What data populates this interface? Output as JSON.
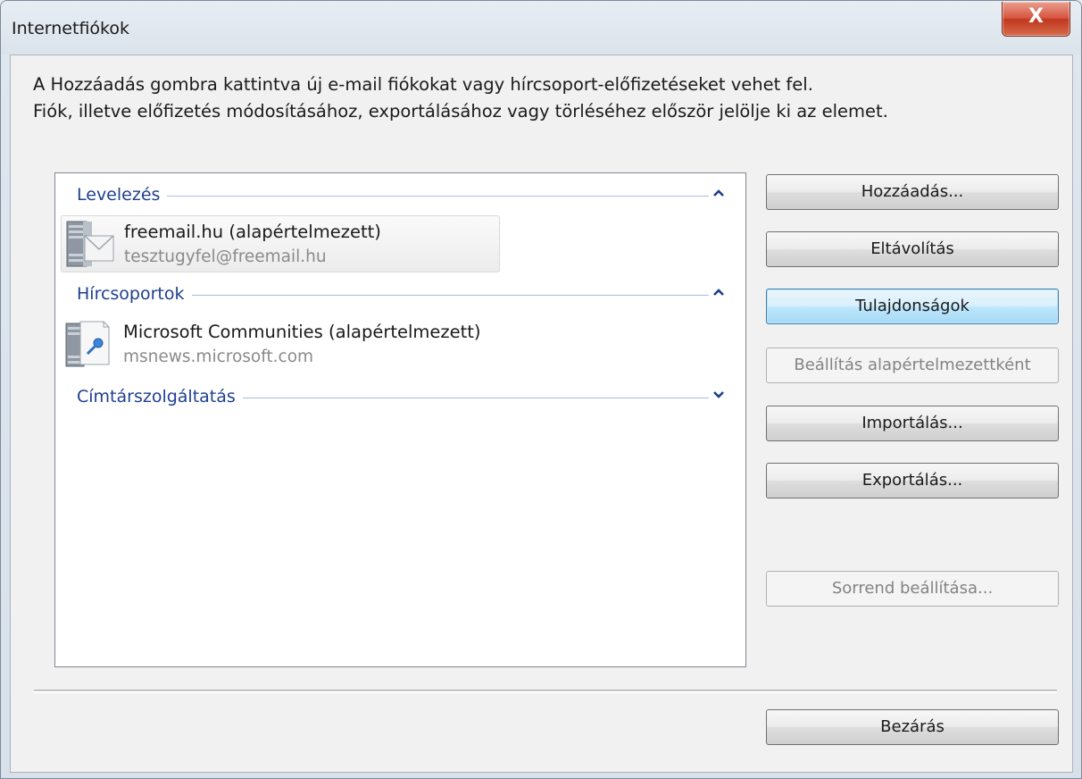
{
  "window": {
    "title": "Internetfiókok",
    "close_glyph": "X"
  },
  "info": {
    "line1": "A Hozzáadás gombra kattintva új e-mail fiókokat vagy hírcsoport-előfizetéseket vehet fel.",
    "line2": "Fiók, illetve előfizetés módosításához, exportálásához vagy törléséhez először jelölje ki az elemet."
  },
  "groups": {
    "mail": {
      "label": "Levelezés",
      "chevron": "^",
      "account": {
        "name": "freemail.hu (alapértelmezett)",
        "detail": "tesztugyfel@freemail.hu",
        "icon": "mail-server-icon"
      }
    },
    "news": {
      "label": "Hírcsoportok",
      "chevron": "^",
      "account": {
        "name": "Microsoft Communities (alapértelmezett)",
        "detail": "msnews.microsoft.com",
        "icon": "news-server-icon"
      }
    },
    "directory": {
      "label": "Címtárszolgáltatás",
      "chevron": "v"
    }
  },
  "buttons": {
    "add": "Hozzáadás...",
    "remove": "Eltávolítás",
    "properties": "Tulajdonságok",
    "set_default": "Beállítás alapértelmezettként",
    "import": "Importálás...",
    "export": "Exportálás...",
    "set_order": "Sorrend beállítása...",
    "close": "Bezárás"
  },
  "colors": {
    "group_header": "#1e3f8f",
    "close_button": "#c1371f",
    "focused_button": "#3c7fb1"
  }
}
